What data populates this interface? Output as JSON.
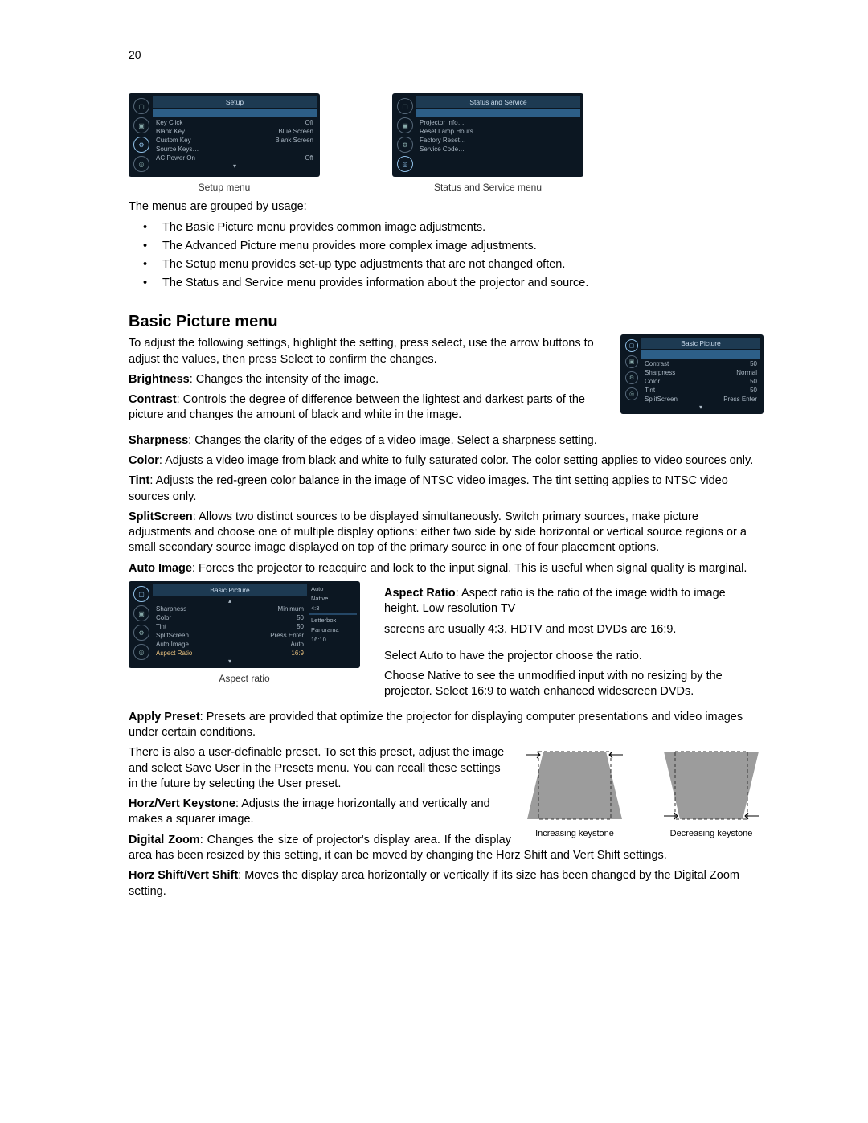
{
  "page_number": "20",
  "menus": {
    "setup": {
      "title": "Setup",
      "caption": "Setup menu",
      "rows": [
        {
          "label": "Key Click",
          "value": "Off"
        },
        {
          "label": "Blank Key",
          "value": "Blue Screen"
        },
        {
          "label": "Custom Key",
          "value": "Blank Screen"
        },
        {
          "label": "Source Keys…",
          "value": ""
        },
        {
          "label": "AC Power On",
          "value": "Off"
        }
      ]
    },
    "status": {
      "title": "Status and Service",
      "caption": "Status and Service menu",
      "rows": [
        {
          "label": "Projector Info…"
        },
        {
          "label": "Reset Lamp Hours…"
        },
        {
          "label": "Factory Reset…"
        },
        {
          "label": "Service Code…"
        }
      ]
    },
    "basic_small": {
      "title": "Basic Picture",
      "rows": [
        {
          "label": "Contrast",
          "value": "50"
        },
        {
          "label": "Sharpness",
          "value": "Normal"
        },
        {
          "label": "Color",
          "value": "50"
        },
        {
          "label": "Tint",
          "value": "50"
        },
        {
          "label": "SplitScreen",
          "value": "Press Enter"
        }
      ]
    },
    "aspect": {
      "title": "Basic Picture",
      "caption": "Aspect ratio",
      "rows": [
        {
          "label": "Sharpness",
          "value": "Minimum"
        },
        {
          "label": "Color",
          "value": "50"
        },
        {
          "label": "Tint",
          "value": "50"
        },
        {
          "label": "SplitScreen",
          "value": "Press Enter"
        },
        {
          "label": "Auto Image",
          "value": "Auto"
        },
        {
          "label": "Aspect Ratio",
          "value": "16:9",
          "selected": true
        }
      ],
      "options": [
        "Auto",
        "Native",
        "4:3",
        "",
        "Letterbox",
        "Panorama",
        "16:10"
      ]
    }
  },
  "intro": "The menus are grouped by usage:",
  "bullets": [
    "The Basic Picture menu provides common image adjustments.",
    "The Advanced Picture menu provides more complex image adjustments.",
    "The Setup menu provides set-up type adjustments that are not changed often.",
    "The Status and Service menu provides information about the projector and source."
  ],
  "heading": "Basic Picture menu",
  "lead": "To adjust the following settings, highlight the setting, press select, use the arrow buttons to adjust the values, then press Select to confirm the changes.",
  "defs": {
    "brightness": {
      "label": "Brightness",
      "text": ": Changes the intensity of the image."
    },
    "contrast": {
      "label": "Contrast",
      "text": ":  Controls the degree of difference between the lightest and darkest parts of the picture and changes the amount of black and white in the image."
    },
    "sharpness": {
      "label": "Sharpness",
      "text": ": Changes the clarity of the edges of a video image. Select a sharpness setting."
    },
    "color": {
      "label": "Color",
      "text": ":  Adjusts a video image from black and white to fully saturated color. The color setting applies to video sources only."
    },
    "tint": {
      "label": "Tint",
      "text": ": Adjusts the red-green color balance in the image of NTSC video images. The tint setting applies to NTSC video sources only."
    },
    "splitscreen": {
      "label": "SplitScreen",
      "text": ": Allows two distinct sources to be displayed simultaneously. Switch primary sources, make picture adjustments and choose one of multiple display options: either two side by side horizontal or vertical source regions or a small secondary source image displayed on top of the primary source in one of four placement options."
    },
    "autoimage": {
      "label": "Auto Image",
      "text": ": Forces the projector to reacquire and lock to the input signal. This is useful when signal quality is marginal."
    },
    "aspect1": {
      "label": "Aspect Ratio",
      "text": ": Aspect ratio is the ratio of the image width to image height. Low resolution TV"
    },
    "aspect2": "screens are usually 4:3. HDTV and most DVDs are 16:9.",
    "aspect3": "Select Auto to have the projector choose the ratio.",
    "aspect4": "Choose Native to see the unmodified input with no resizing by the projector. Select 16:9 to watch enhanced widescreen DVDs.",
    "apply": {
      "label": "Apply Preset",
      "text": ": Presets are provided that optimize the projector for displaying computer presentations and video images under certain conditions."
    },
    "userpreset": "There is also a user-definable preset. To set this preset, adjust the image and select Save User in the Presets menu. You can recall these settings in the future by selecting the User preset.",
    "keystone": {
      "label": "Horz/Vert Keystone",
      "text": ": Adjusts the image horizontally and vertically and makes a squarer image."
    },
    "digitalzoom": {
      "label": "Digital Zoom",
      "text": ": Changes the size of projector's display area. If the display area has been resized by this setting, it can be moved by changing the Horz Shift and Vert Shift settings."
    },
    "shift": {
      "label": "Horz Shift/Vert Shift",
      "text": ": Moves the display area horizontally or vertically if its size has been changed by the Digital Zoom setting."
    }
  },
  "keystone": {
    "inc": "Increasing keystone",
    "dec": "Decreasing keystone"
  }
}
